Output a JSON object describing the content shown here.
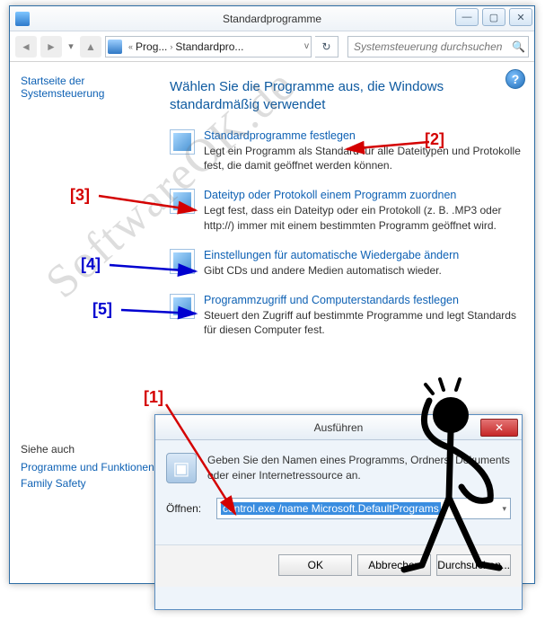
{
  "mainWindow": {
    "title": "Standardprogramme",
    "breadcrumb": {
      "seg1": "Prog...",
      "seg2": "Standardpro..."
    },
    "searchPlaceholder": "Systemsteuerung durchsuchen",
    "sidebar": {
      "home": "Startseite der Systemsteuerung",
      "seeAlsoTitle": "Siehe auch",
      "seeAlso1": "Programme und Funktionen",
      "seeAlso2": "Family Safety"
    },
    "heading": "Wählen Sie die Programme aus, die Windows standardmäßig verwendet",
    "options": [
      {
        "link": "Standardprogramme festlegen",
        "desc": "Legt ein Programm als Standard für alle Dateitypen und Protokolle fest, die damit geöffnet werden können."
      },
      {
        "link": "Dateityp oder Protokoll einem Programm zuordnen",
        "desc": "Legt fest, dass ein Dateityp oder ein Protokoll (z. B. .MP3 oder http://) immer mit einem bestimmten Programm geöffnet wird."
      },
      {
        "link": "Einstellungen für automatische Wiedergabe ändern",
        "desc": "Gibt CDs und andere Medien automatisch wieder."
      },
      {
        "link": "Programmzugriff und Computerstandards festlegen",
        "desc": "Steuert den Zugriff auf bestimmte Programme und legt Standards für diesen Computer fest."
      }
    ]
  },
  "runDialog": {
    "title": "Ausführen",
    "desc": "Geben Sie den Namen eines Programms, Ordners, Dokuments oder einer Internetressource an.",
    "openLabel": "Öffnen:",
    "value": "control.exe /name Microsoft.DefaultPrograms",
    "btnOk": "OK",
    "btnCancel": "Abbrechen",
    "btnBrowse": "Durchsuchen..."
  },
  "annotations": {
    "n1": "[1]",
    "n2": "[2]",
    "n3": "[3]",
    "n4": "[4]",
    "n5": "[5]"
  },
  "watermark": "SoftwareOK.de"
}
